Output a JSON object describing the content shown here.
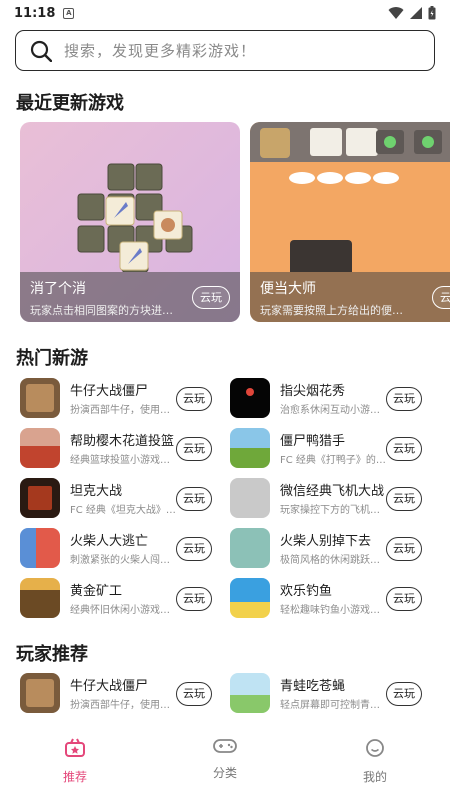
{
  "status_bar": {
    "time": "11:18",
    "notif_glyph": "A"
  },
  "search": {
    "placeholder": "搜索，发现更多精彩游戏！"
  },
  "sections": {
    "recent": "最近更新游戏",
    "hot": "热门新游",
    "players": "玩家推荐"
  },
  "recent_games": [
    {
      "title": "消了个消",
      "desc": "玩家点击相同图案的方块进…",
      "button": "云玩"
    },
    {
      "title": "便当大师",
      "desc": "玩家需要按照上方给出的便…",
      "button": "云玩"
    }
  ],
  "hot_games": [
    {
      "name": "牛仔大战僵尸",
      "desc": "扮演西部牛仔，使用…",
      "button": "云玩"
    },
    {
      "name": "指尖烟花秀",
      "desc": "治愈系休闲互动小游…",
      "button": "云玩"
    },
    {
      "name": "帮助樱木花道投篮",
      "desc": "经典篮球投篮小游戏…",
      "button": "云玩"
    },
    {
      "name": "僵尸鸭猎手",
      "desc": "FC 经典《打鸭子》的…",
      "button": "云玩"
    },
    {
      "name": "坦克大战",
      "desc": "FC 经典《坦克大战》…",
      "button": "云玩"
    },
    {
      "name": "微信经典飞机大战",
      "desc": "玩家操控下方的飞机…",
      "button": "云玩"
    },
    {
      "name": "火柴人大逃亡",
      "desc": "刺激紧张的火柴人闯…",
      "button": "云玩"
    },
    {
      "name": "火柴人别掉下去",
      "desc": "极简风格的休闲跳跃…",
      "button": "云玩"
    },
    {
      "name": "黄金矿工",
      "desc": "经典怀旧休闲小游戏…",
      "button": "云玩"
    },
    {
      "name": "欢乐钓鱼",
      "desc": "轻松趣味钓鱼小游戏…",
      "button": "云玩"
    }
  ],
  "player_games": [
    {
      "name": "牛仔大战僵尸",
      "desc": "扮演西部牛仔，使用…",
      "button": "云玩"
    },
    {
      "name": "青蛙吃苍蝇",
      "desc": "轻点屏幕即可控制青…",
      "button": "云玩"
    }
  ],
  "nav": [
    {
      "label": "推荐",
      "icon": "gift-box-icon"
    },
    {
      "label": "分类",
      "icon": "gamepad-icon"
    },
    {
      "label": "我的",
      "icon": "smiley-icon"
    }
  ],
  "colors": {
    "accent": "#e4477a",
    "card_bg_1": "#e7b7d3",
    "card_bg_2": "#f4a15f"
  }
}
